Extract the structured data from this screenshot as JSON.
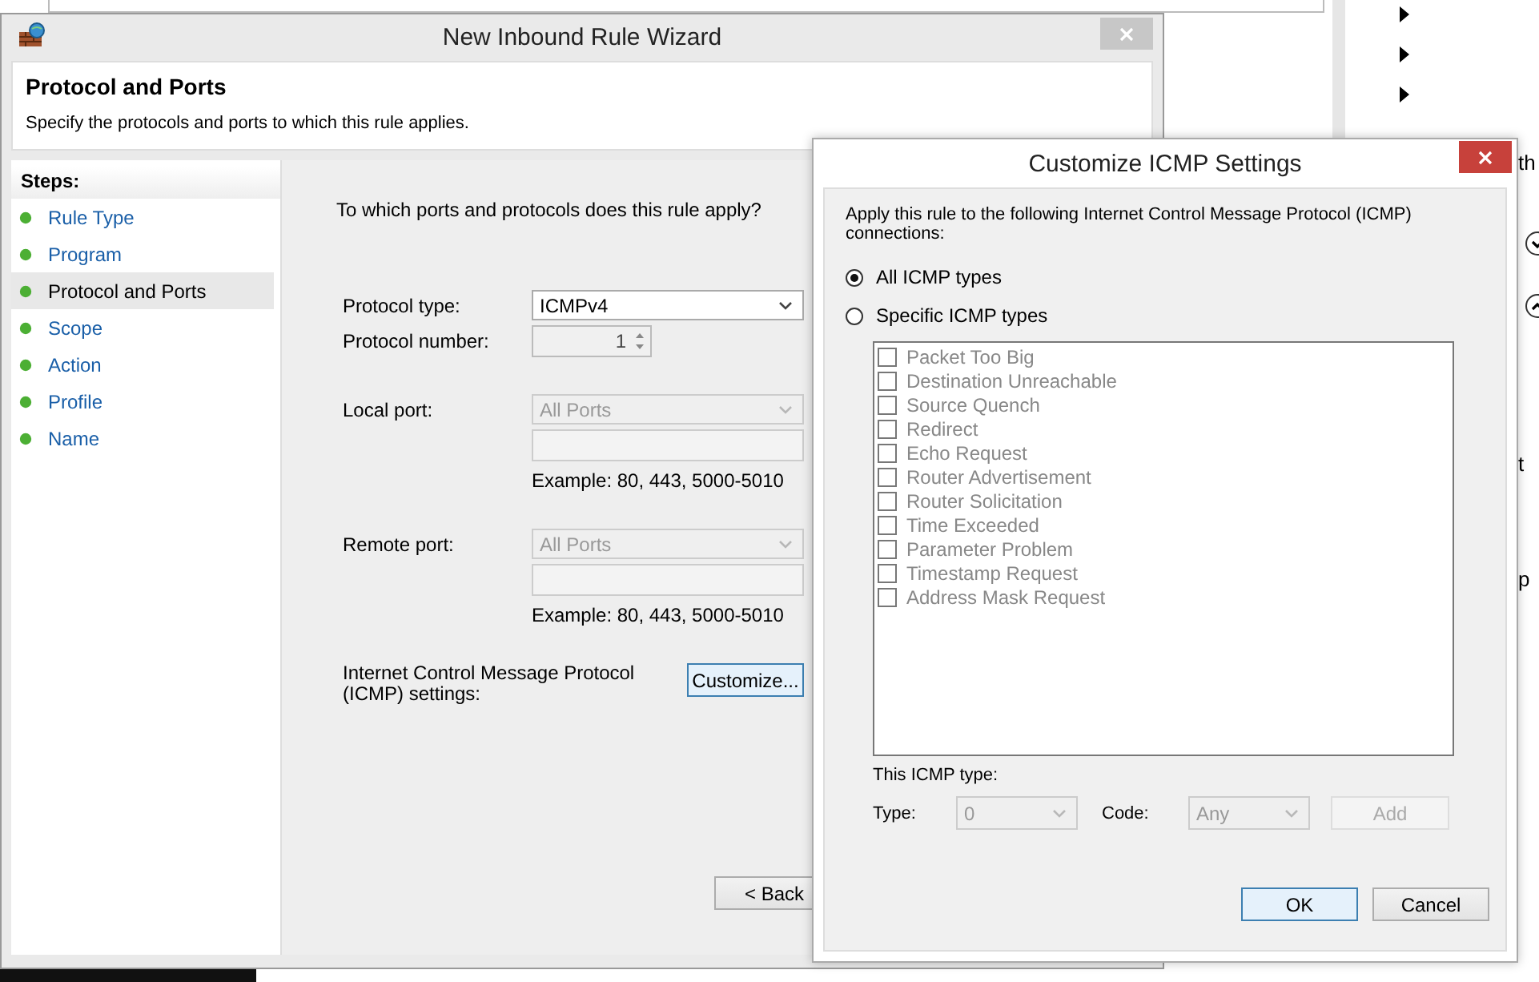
{
  "background": {
    "texts": [
      {
        "text": "th",
        "kind": "pane"
      },
      {
        "text": "t",
        "kind": "pane"
      },
      {
        "text": "p",
        "kind": "pane"
      }
    ]
  },
  "wizard": {
    "title": "New Inbound Rule Wizard",
    "heading": "Protocol and Ports",
    "subtitle": "Specify the protocols and ports to which this rule applies.",
    "steps_label": "Steps:",
    "steps": [
      {
        "label": "Rule Type",
        "selected": false
      },
      {
        "label": "Program",
        "selected": false
      },
      {
        "label": "Protocol and Ports",
        "selected": true
      },
      {
        "label": "Scope",
        "selected": false
      },
      {
        "label": "Action",
        "selected": false
      },
      {
        "label": "Profile",
        "selected": false
      },
      {
        "label": "Name",
        "selected": false
      }
    ],
    "question": "To which ports and protocols does this rule apply?",
    "protocol_type": {
      "label": "Protocol type:",
      "value": "ICMPv4",
      "disabled": false
    },
    "protocol_number": {
      "label": "Protocol number:",
      "value": "1",
      "disabled": true
    },
    "local_port": {
      "label": "Local port:",
      "value": "All Ports",
      "disabled": true,
      "example": "Example: 80, 443, 5000-5010"
    },
    "remote_port": {
      "label": "Remote port:",
      "value": "All Ports",
      "disabled": true,
      "example": "Example: 80, 443, 5000-5010"
    },
    "icmp": {
      "label": "Internet Control Message Protocol (ICMP) settings:",
      "button": "Customize..."
    },
    "buttons": [
      "< Back"
    ]
  },
  "dialog": {
    "title": "Customize ICMP Settings",
    "intro": "Apply this rule to the following Internet Control Message Protocol (ICMP) connections:",
    "options": [
      {
        "label": "All ICMP types",
        "selected": true
      },
      {
        "label": "Specific ICMP types",
        "selected": false
      }
    ],
    "icmp_types": [
      {
        "label": "Packet Too Big",
        "checked": false,
        "disabled": true
      },
      {
        "label": "Destination Unreachable",
        "checked": false,
        "disabled": true
      },
      {
        "label": "Source Quench",
        "checked": false,
        "disabled": true
      },
      {
        "label": "Redirect",
        "checked": false,
        "disabled": true
      },
      {
        "label": "Echo Request",
        "checked": false,
        "disabled": true
      },
      {
        "label": "Router Advertisement",
        "checked": false,
        "disabled": true
      },
      {
        "label": "Router Solicitation",
        "checked": false,
        "disabled": true
      },
      {
        "label": "Time Exceeded",
        "checked": false,
        "disabled": true
      },
      {
        "label": "Parameter Problem",
        "checked": false,
        "disabled": true
      },
      {
        "label": "Timestamp Request",
        "checked": false,
        "disabled": true
      },
      {
        "label": "Address Mask Request",
        "checked": false,
        "disabled": true
      }
    ],
    "this_type_label": "This ICMP type:",
    "type": {
      "label": "Type:",
      "value": "0",
      "disabled": true
    },
    "code": {
      "label": "Code:",
      "value": "Any",
      "disabled": true
    },
    "add_button": {
      "label": "Add",
      "disabled": true
    },
    "buttons": [
      {
        "label": "OK",
        "kind": "default"
      },
      {
        "label": "Cancel",
        "kind": "normal"
      }
    ]
  }
}
